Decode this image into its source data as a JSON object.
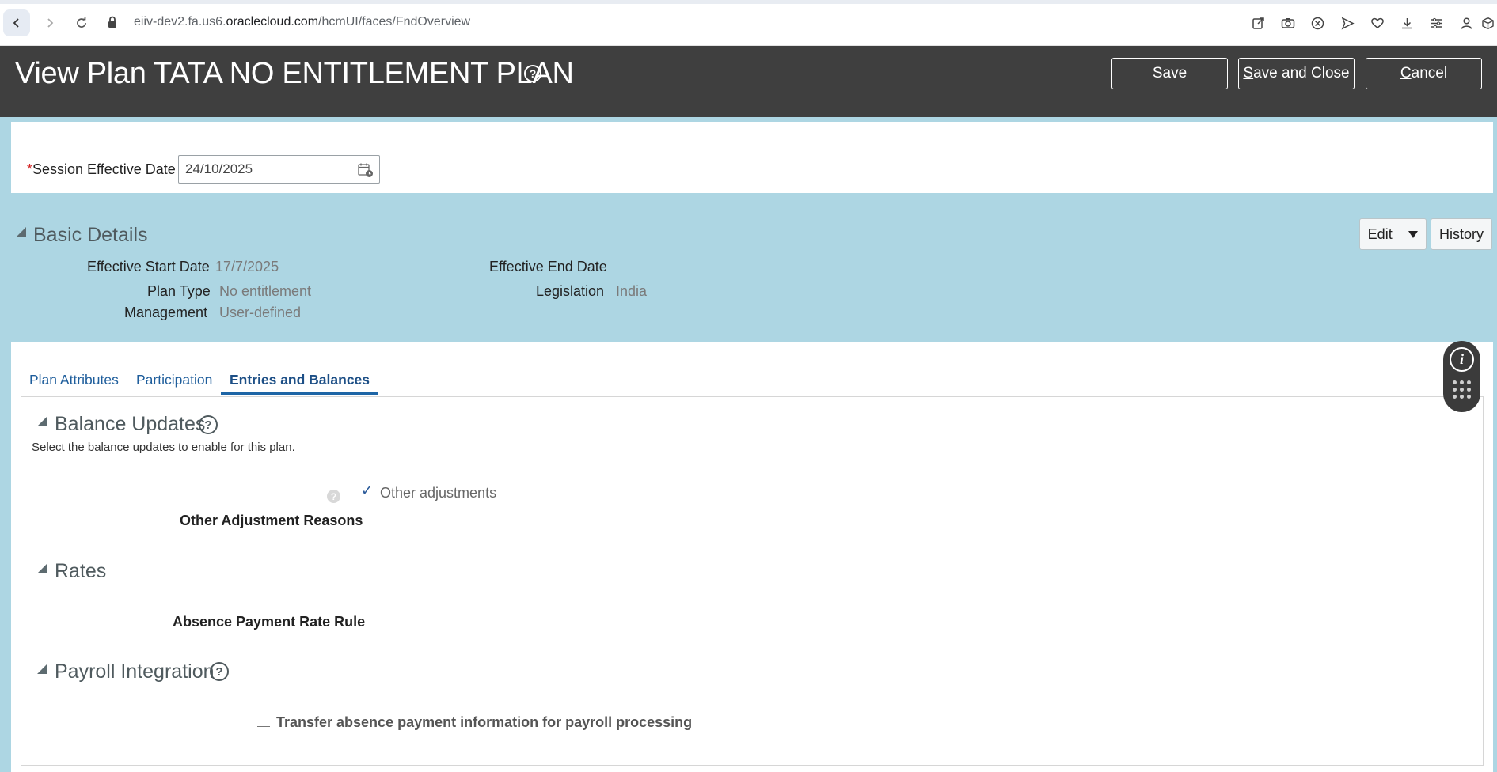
{
  "browser": {
    "url_prefix": "eiiv-dev2.fa.us6.",
    "url_host": "oraclecloud.com",
    "url_path": "/hcmUI/faces/FndOverview",
    "toolbar_icons": [
      "share-icon",
      "camera-icon",
      "close-circle-icon",
      "send-icon",
      "heart-icon",
      "download-icon",
      "settings-icon",
      "profile-icon"
    ]
  },
  "header": {
    "title": "View Plan TATA NO ENTITLEMENT PLAN",
    "help_glyph": "?",
    "save_label": "Save",
    "save_close_first": "S",
    "save_close_rest": "ave and Close",
    "cancel_first": "C",
    "cancel_rest": "ancel"
  },
  "session": {
    "required_marker": "*",
    "label": "Session Effective Date",
    "value": "24/10/2025"
  },
  "basic_details": {
    "title": "Basic Details",
    "effective_start_label": "Effective Start Date",
    "effective_start_value": "17/7/2025",
    "effective_end_label": "Effective End Date",
    "effective_end_value": "",
    "plan_type_label": "Plan Type",
    "plan_type_value": "No entitlement",
    "legislation_label": "Legislation",
    "legislation_value": "India",
    "management_label": "Management",
    "management_value": "User-defined",
    "edit_label": "Edit",
    "history_label": "History"
  },
  "tabs": [
    {
      "label": "Plan Attributes",
      "active": false
    },
    {
      "label": "Participation",
      "active": false
    },
    {
      "label": "Entries and Balances",
      "active": true
    }
  ],
  "balance_updates": {
    "title": "Balance Updates",
    "instruction": "Select the balance updates to enable for this plan.",
    "option_label": "Other adjustments",
    "option_checked": true,
    "reasons_label": "Other Adjustment Reasons"
  },
  "rates": {
    "title": "Rates",
    "rule_label": "Absence Payment Rate Rule"
  },
  "payroll": {
    "title": "Payroll Integration",
    "transfer_label": "Transfer absence payment information for payroll processing"
  },
  "colors": {
    "header_bg": "#3f3f3f",
    "content_bg": "#add6e3",
    "tab_accent": "#1d65a6"
  }
}
